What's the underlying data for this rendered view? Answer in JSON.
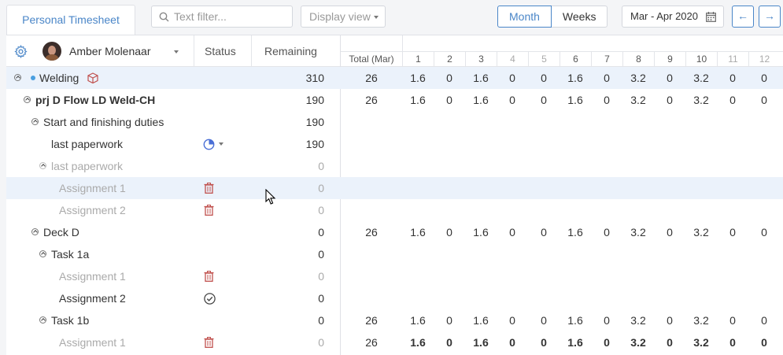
{
  "tab": {
    "label": "Personal Timesheet"
  },
  "search": {
    "placeholder": "Text filter..."
  },
  "display_view": {
    "label": "Display view"
  },
  "view_toggle": {
    "month": "Month",
    "weeks": "Weeks"
  },
  "date_range": {
    "label": "Mar - Apr 2020"
  },
  "nav": {
    "prev": "←",
    "next": "→"
  },
  "header": {
    "user": "Amber Molenaar",
    "status": "Status",
    "remaining": "Remaining",
    "total": "Total (Mar)",
    "days": [
      "1",
      "2",
      "3",
      "4",
      "5",
      "6",
      "7",
      "8",
      "9",
      "10",
      "11",
      "12"
    ]
  },
  "rows": [
    {
      "label": "Welding",
      "remaining": "310",
      "total": "26",
      "days": [
        "1.6",
        "0",
        "1.6",
        "0",
        "0",
        "1.6",
        "0",
        "3.2",
        "0",
        "3.2",
        "0",
        "0"
      ]
    },
    {
      "label": "prj D Flow LD Weld-CH",
      "remaining": "190",
      "total": "26",
      "days": [
        "1.6",
        "0",
        "1.6",
        "0",
        "0",
        "1.6",
        "0",
        "3.2",
        "0",
        "3.2",
        "0",
        "0"
      ]
    },
    {
      "label": "Start and finishing duties",
      "remaining": "190"
    },
    {
      "label": "last paperwork",
      "remaining": "190"
    },
    {
      "label": "last paperwork",
      "remaining": "0"
    },
    {
      "label": "Assignment 1",
      "remaining": "0"
    },
    {
      "label": "Assignment 2",
      "remaining": "0"
    },
    {
      "label": "Deck D",
      "remaining": "0",
      "total": "26",
      "days": [
        "1.6",
        "0",
        "1.6",
        "0",
        "0",
        "1.6",
        "0",
        "3.2",
        "0",
        "3.2",
        "0",
        "0"
      ]
    },
    {
      "label": "Task 1a",
      "remaining": "0"
    },
    {
      "label": "Assignment 1",
      "remaining": "0"
    },
    {
      "label": "Assignment 2",
      "remaining": "0"
    },
    {
      "label": "Task 1b",
      "remaining": "0",
      "total": "26",
      "days": [
        "1.6",
        "0",
        "1.6",
        "0",
        "0",
        "1.6",
        "0",
        "3.2",
        "0",
        "3.2",
        "0",
        "0"
      ]
    },
    {
      "label": "Assignment 1",
      "remaining": "0",
      "total": "26",
      "days": [
        "1.6",
        "0",
        "1.6",
        "0",
        "0",
        "1.6",
        "0",
        "3.2",
        "0",
        "3.2",
        "0",
        "0"
      ]
    }
  ],
  "colors": {
    "accent": "#4a86c8",
    "highlight": "#ebf2fb",
    "trash": "#c0504d",
    "muted": "#aaaaaa"
  }
}
